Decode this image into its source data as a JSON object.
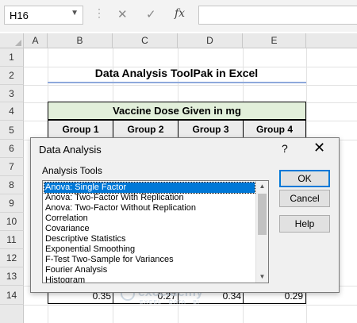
{
  "formula_bar": {
    "name_box": "H16",
    "cancel_glyph": "✕",
    "enter_glyph": "✓",
    "fx_label": "fx",
    "formula_value": ""
  },
  "columns": [
    "A",
    "B",
    "C",
    "D",
    "E"
  ],
  "rows": [
    "1",
    "2",
    "3",
    "4",
    "5",
    "6",
    "7",
    "8",
    "9",
    "10",
    "11",
    "12",
    "13",
    "14"
  ],
  "sheet": {
    "title": "Data Analysis ToolPak in Excel",
    "table_header": "Vaccine Dose Given in mg",
    "groups": [
      "Group 1",
      "Group 2",
      "Group 3",
      "Group 4"
    ],
    "row14_values": [
      "0.35",
      "0.27",
      "0.34",
      "0.29"
    ],
    "header_fill": "#e2efda"
  },
  "dialog": {
    "title": "Data Analysis",
    "help_glyph": "?",
    "close_glyph": "✕",
    "list_label": "Analysis Tools",
    "items": [
      "Anova: Single Factor",
      "Anova: Two-Factor With Replication",
      "Anova: Two-Factor Without Replication",
      "Correlation",
      "Covariance",
      "Descriptive Statistics",
      "Exponential Smoothing",
      "F-Test Two-Sample for Variances",
      "Fourier Analysis",
      "Histogram"
    ],
    "selected_item": "Anova: Single Factor",
    "buttons": {
      "ok": "OK",
      "cancel": "Cancel",
      "help": "Help"
    },
    "accent": "#0078d7"
  },
  "watermark": {
    "name": "exceldemy",
    "tagline": "EXCEL · DATA · BI"
  }
}
